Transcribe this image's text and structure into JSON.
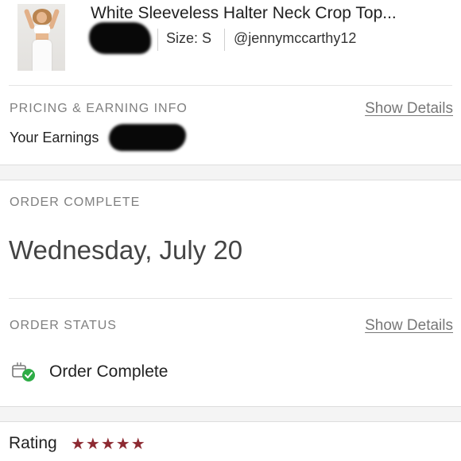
{
  "product": {
    "title": "White Sleeveless Halter Neck Crop Top...",
    "size": "Size: S",
    "seller": "@jennymccarthy12",
    "image_icon": "product-photo"
  },
  "pricing": {
    "section_label": "PRICING & EARNING INFO",
    "show_details": "Show Details",
    "earnings_label": "Your Earnings"
  },
  "order_complete": {
    "section_label": "ORDER COMPLETE",
    "date": "Wednesday, July 20"
  },
  "order_status": {
    "section_label": "ORDER STATUS",
    "show_details": "Show Details",
    "status_text": "Order Complete",
    "status_icon": "box-check-icon",
    "status_color": "#2eac46"
  },
  "rating": {
    "label": "Rating",
    "stars": "★★★★★",
    "value": 5,
    "max": 5,
    "star_color": "#8d2a32"
  }
}
